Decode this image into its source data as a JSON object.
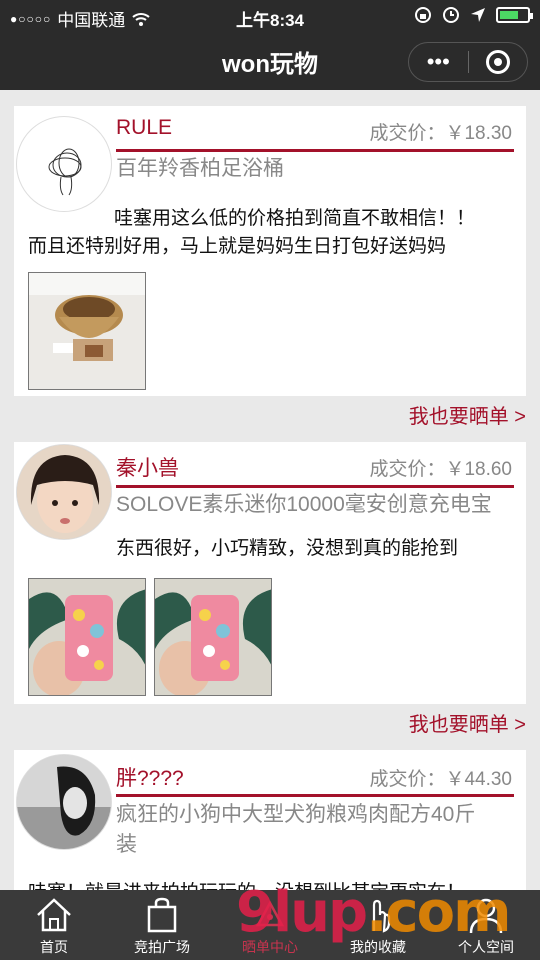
{
  "status_bar": {
    "carrier": "中国联通",
    "time": "上午8:34"
  },
  "header": {
    "title": "won玩物"
  },
  "posts": [
    {
      "user": "RULE",
      "price": "成交价：￥18.30",
      "product": "百年羚香柏足浴桶",
      "comment_lines": [
        "哇塞用这么低的价格拍到简直不敢相信！！",
        "而且还特别好用，马上就是妈妈生日打包好送妈妈"
      ],
      "more": "我也要晒单 >"
    },
    {
      "user": "秦小兽",
      "price": "成交价：￥18.60",
      "product": "SOLOVE素乐迷你10000毫安创意充电宝",
      "comment_lines": [
        "东西很好，小巧精致，没想到真的能抢到"
      ],
      "more": "我也要晒单 >"
    },
    {
      "user": "胖????",
      "price": "成交价：￥44.30",
      "product_lines": [
        "疯狂的小狗中大型犬狗粮鸡肉配方40斤",
        "装"
      ],
      "comment_lines": [
        "哇塞！就是进来拍拍玩玩的，没想到比某宝更实在！"
      ]
    }
  ],
  "tabs": [
    {
      "label": "首页",
      "icon": "home-icon"
    },
    {
      "label": "竞拍广场",
      "icon": "bag-icon"
    },
    {
      "label": "晒单中心",
      "icon": "share-icon",
      "active": true
    },
    {
      "label": "我的收藏",
      "icon": "hand-icon"
    },
    {
      "label": "个人空间",
      "icon": "user-icon"
    }
  ],
  "watermark": {
    "main": "9lup",
    "suffix": ".com"
  },
  "colors": {
    "accent": "#a3112a",
    "bar": "#2b2b2b",
    "tabbar": "#3a3a3a"
  }
}
